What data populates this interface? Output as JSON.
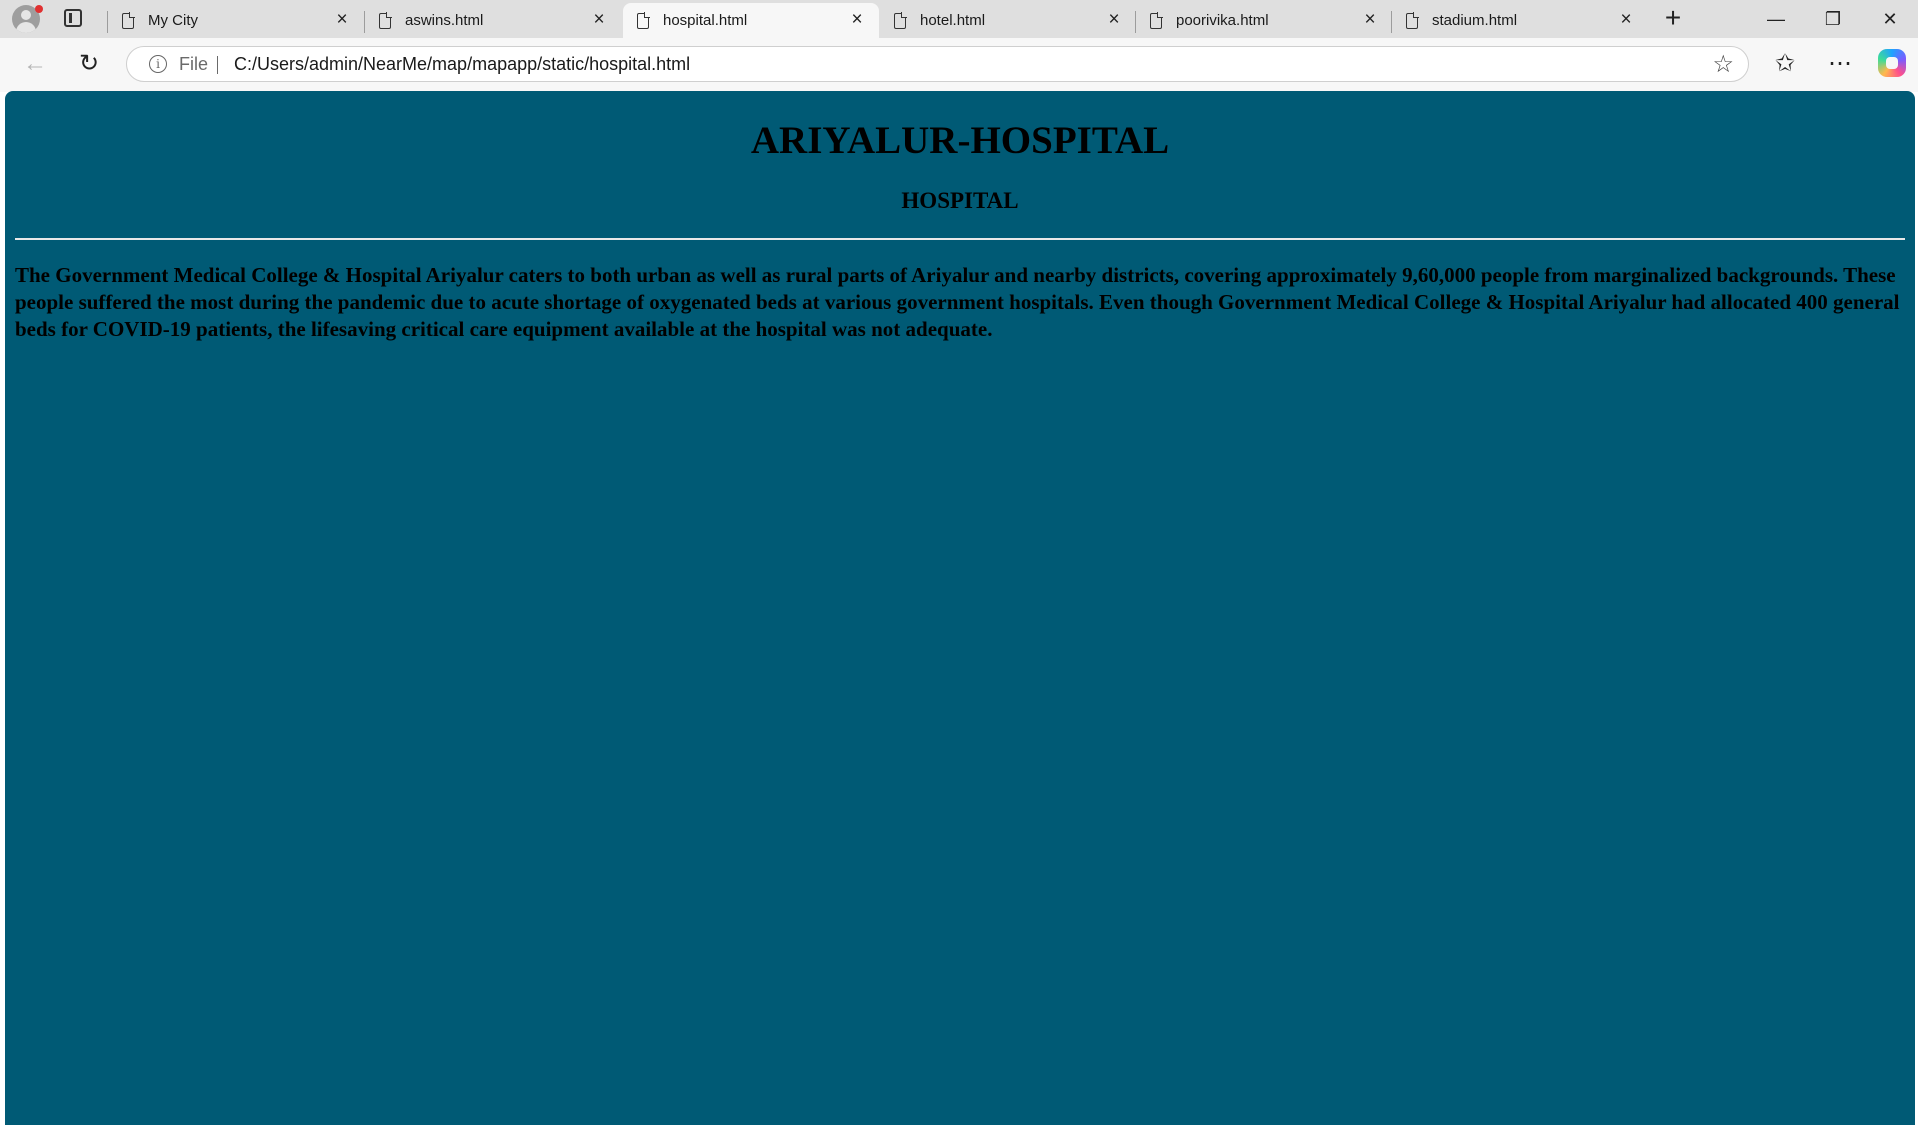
{
  "browser": {
    "tabs": [
      {
        "label": "My City",
        "active": false
      },
      {
        "label": "aswins.html",
        "active": false
      },
      {
        "label": "hospital.html",
        "active": true
      },
      {
        "label": "hotel.html",
        "active": false
      },
      {
        "label": "poorivika.html",
        "active": false
      },
      {
        "label": "stadium.html",
        "active": false
      }
    ],
    "address": {
      "scheme_label": "File",
      "url": "C:/Users/admin/NearMe/map/mapapp/static/hospital.html"
    }
  },
  "page": {
    "title": "ARIYALUR-HOSPITAL",
    "subtitle": "HOSPITAL",
    "body_text": "The Government Medical College & Hospital Ariyalur caters to both urban as well as rural parts of Ariyalur and nearby districts, covering approximately 9,60,000 people from marginalized backgrounds. These people suffered the most during the pandemic due to acute shortage of oxygenated beds at various government hospitals. Even though Government Medical College & Hospital Ariyalur had allocated 400 general beds for COVID-19 patients, the lifesaving critical care equipment available at the hospital was not adequate.",
    "background_color": "#005a75"
  }
}
